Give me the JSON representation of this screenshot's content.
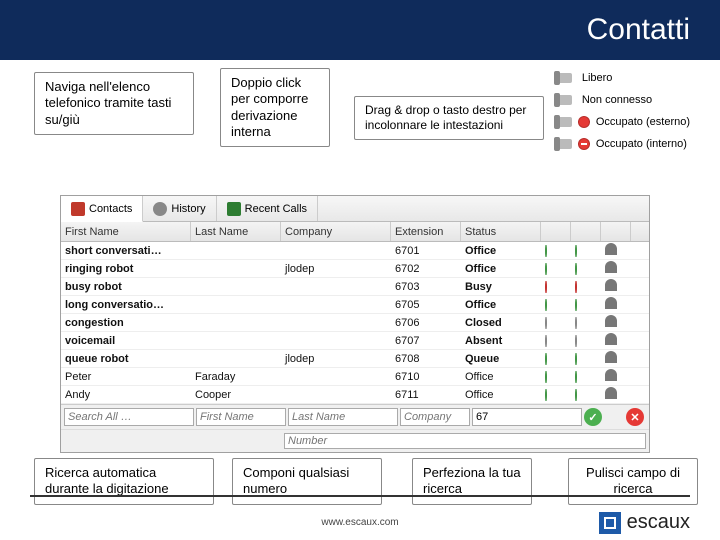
{
  "header": {
    "title": "Contatti"
  },
  "callouts": {
    "navigate": "Naviga nell'elenco telefonico tramite tasti su/giù",
    "doubleclick": "Doppio click per comporre derivazione interna",
    "dragdrop": "Drag & drop o tasto destro per incolonnare le intestazioni",
    "autosearch": "Ricerca automatica durante la digitazione",
    "compose": "Componi qualsiasi numero",
    "refine": "Perfeziona la tua ricerca",
    "clear": "Pulisci campo di ricerca"
  },
  "legend": {
    "free": "Libero",
    "not_connected": "Non connesso",
    "busy_ext": "Occupato (esterno)",
    "busy_int": "Occupato (interno)"
  },
  "tabs": {
    "contacts": "Contacts",
    "history": "History",
    "recent": "Recent Calls"
  },
  "columns": {
    "first": "First Name",
    "last": "Last Name",
    "company": "Company",
    "ext": "Extension",
    "status": "Status"
  },
  "rows": [
    {
      "first": "short conversati…",
      "last": "",
      "company": "",
      "ext": "6701",
      "status": "Office",
      "s1": "green",
      "s2": "green",
      "bold": true
    },
    {
      "first": "ringing robot",
      "last": "",
      "company": "jlodep",
      "ext": "6702",
      "status": "Office",
      "s1": "green",
      "s2": "green",
      "bold": true
    },
    {
      "first": "busy robot",
      "last": "",
      "company": "",
      "ext": "6703",
      "status": "Busy",
      "s1": "red",
      "s2": "red",
      "bold": true
    },
    {
      "first": "long conversatio…",
      "last": "",
      "company": "",
      "ext": "6705",
      "status": "Office",
      "s1": "green",
      "s2": "green",
      "bold": true
    },
    {
      "first": "congestion",
      "last": "",
      "company": "",
      "ext": "6706",
      "status": "Closed",
      "s1": "gray",
      "s2": "gray",
      "bold": true
    },
    {
      "first": "voicemail",
      "last": "",
      "company": "",
      "ext": "6707",
      "status": "Absent",
      "s1": "gray",
      "s2": "gray",
      "bold": true
    },
    {
      "first": "queue robot",
      "last": "",
      "company": "jlodep",
      "ext": "6708",
      "status": "Queue",
      "s1": "green",
      "s2": "green",
      "bold": true
    },
    {
      "first": "Peter",
      "last": "Faraday",
      "company": "",
      "ext": "6710",
      "status": "Office",
      "s1": "green",
      "s2": "green",
      "bold": false
    },
    {
      "first": "Andy",
      "last": "Cooper",
      "company": "",
      "ext": "6711",
      "status": "Office",
      "s1": "green",
      "s2": "green",
      "bold": false
    }
  ],
  "filters": {
    "search_all": "Search All …",
    "first": "First Name",
    "last": "Last Name",
    "company": "Company",
    "value": "67",
    "number": "Number"
  },
  "footer": {
    "url": "www.escaux.com",
    "brand": "escaux"
  }
}
